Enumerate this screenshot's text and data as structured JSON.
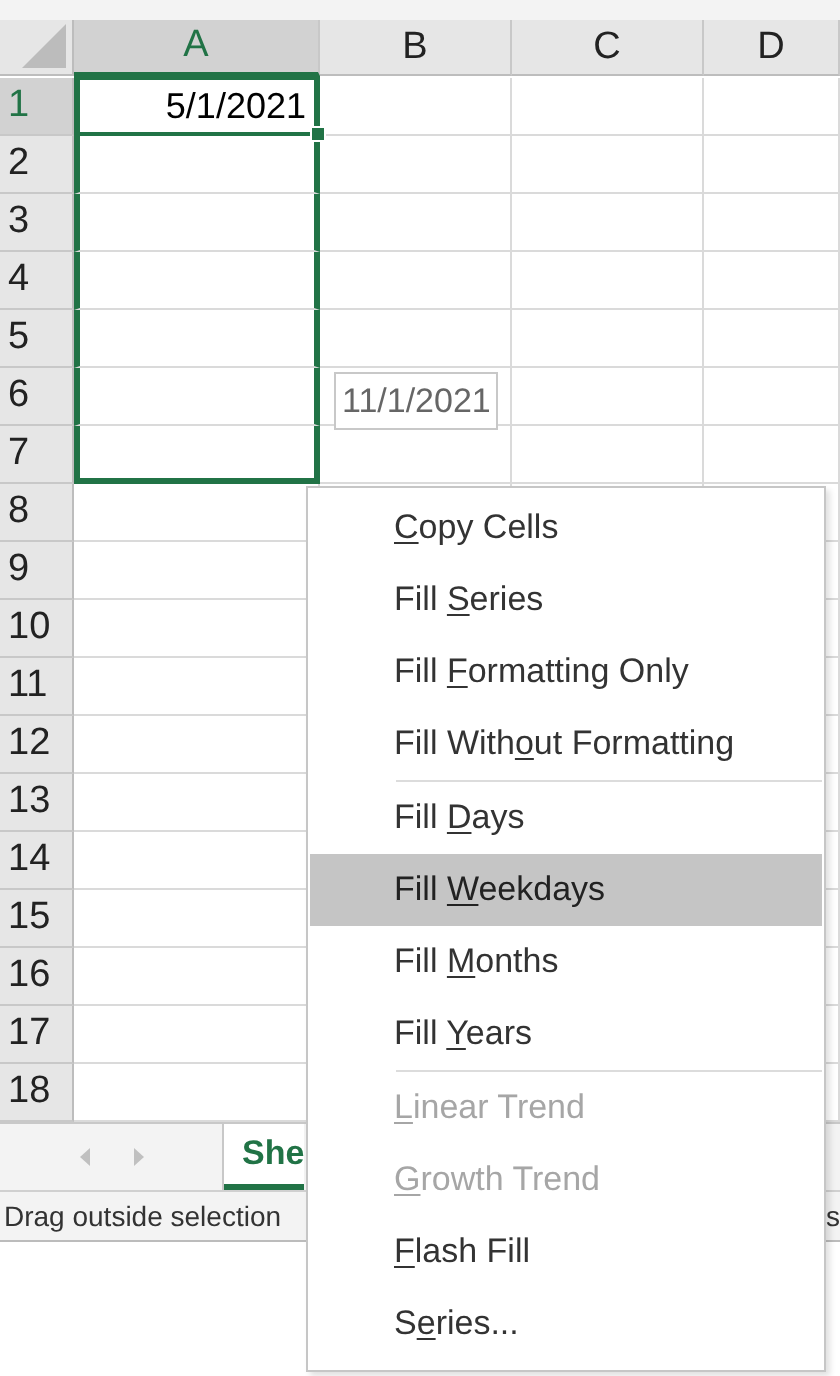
{
  "columns": [
    {
      "label": "A",
      "selected": true
    },
    {
      "label": "B",
      "selected": false
    },
    {
      "label": "C",
      "selected": false
    },
    {
      "label": "D",
      "selected": false
    }
  ],
  "rows": [
    {
      "number": "1",
      "active": true,
      "in_selection": true,
      "value_a": "5/1/2021"
    },
    {
      "number": "2",
      "active": false,
      "in_selection": true
    },
    {
      "number": "3",
      "active": false,
      "in_selection": true
    },
    {
      "number": "4",
      "active": false,
      "in_selection": true
    },
    {
      "number": "5",
      "active": false,
      "in_selection": true
    },
    {
      "number": "6",
      "active": false,
      "in_selection": true
    },
    {
      "number": "7",
      "active": false,
      "in_selection": true
    },
    {
      "number": "8",
      "active": false,
      "in_selection": false
    },
    {
      "number": "9",
      "active": false,
      "in_selection": false
    },
    {
      "number": "10",
      "active": false,
      "in_selection": false
    },
    {
      "number": "11",
      "active": false,
      "in_selection": false
    },
    {
      "number": "12",
      "active": false,
      "in_selection": false
    },
    {
      "number": "13",
      "active": false,
      "in_selection": false
    },
    {
      "number": "14",
      "active": false,
      "in_selection": false
    },
    {
      "number": "15",
      "active": false,
      "in_selection": false
    },
    {
      "number": "16",
      "active": false,
      "in_selection": false
    },
    {
      "number": "17",
      "active": false,
      "in_selection": false
    },
    {
      "number": "18",
      "active": false,
      "in_selection": false
    }
  ],
  "fill_tooltip": "11/1/2021",
  "sheet_tabs": [
    {
      "label": "She",
      "selected": true
    }
  ],
  "status_bar": {
    "text": "Drag outside selection",
    "right_text": "s"
  },
  "context_menu": [
    {
      "kind": "item",
      "access_key": "C",
      "text_after": "opy Cells",
      "disabled": false,
      "selected": false
    },
    {
      "kind": "item",
      "text_before": "Fill ",
      "access_key": "S",
      "text_after": "eries",
      "disabled": false,
      "selected": false
    },
    {
      "kind": "item",
      "text_before": "Fill ",
      "access_key": "F",
      "text_after": "ormatting Only",
      "disabled": false,
      "selected": false
    },
    {
      "kind": "item",
      "text_before": "Fill With",
      "access_key": "o",
      "text_after": "ut Formatting",
      "disabled": false,
      "selected": false
    },
    {
      "kind": "separator"
    },
    {
      "kind": "item",
      "text_before": "Fill ",
      "access_key": "D",
      "text_after": "ays",
      "disabled": false,
      "selected": false
    },
    {
      "kind": "item",
      "text_before": "Fill ",
      "access_key": "W",
      "text_after": "eekdays",
      "disabled": false,
      "selected": true
    },
    {
      "kind": "item",
      "text_before": "Fill ",
      "access_key": "M",
      "text_after": "onths",
      "disabled": false,
      "selected": false
    },
    {
      "kind": "item",
      "text_before": "Fill ",
      "access_key": "Y",
      "text_after": "ears",
      "disabled": false,
      "selected": false
    },
    {
      "kind": "separator"
    },
    {
      "kind": "item",
      "access_key": "L",
      "text_after": "inear Trend",
      "disabled": true,
      "selected": false
    },
    {
      "kind": "item",
      "access_key": "G",
      "text_after": "rowth Trend",
      "disabled": true,
      "selected": false
    },
    {
      "kind": "item",
      "access_key": "F",
      "text_after": "lash Fill",
      "disabled": false,
      "selected": false
    },
    {
      "kind": "item",
      "text_before": "S",
      "access_key": "e",
      "text_after": "ries...",
      "disabled": false,
      "selected": false
    }
  ]
}
